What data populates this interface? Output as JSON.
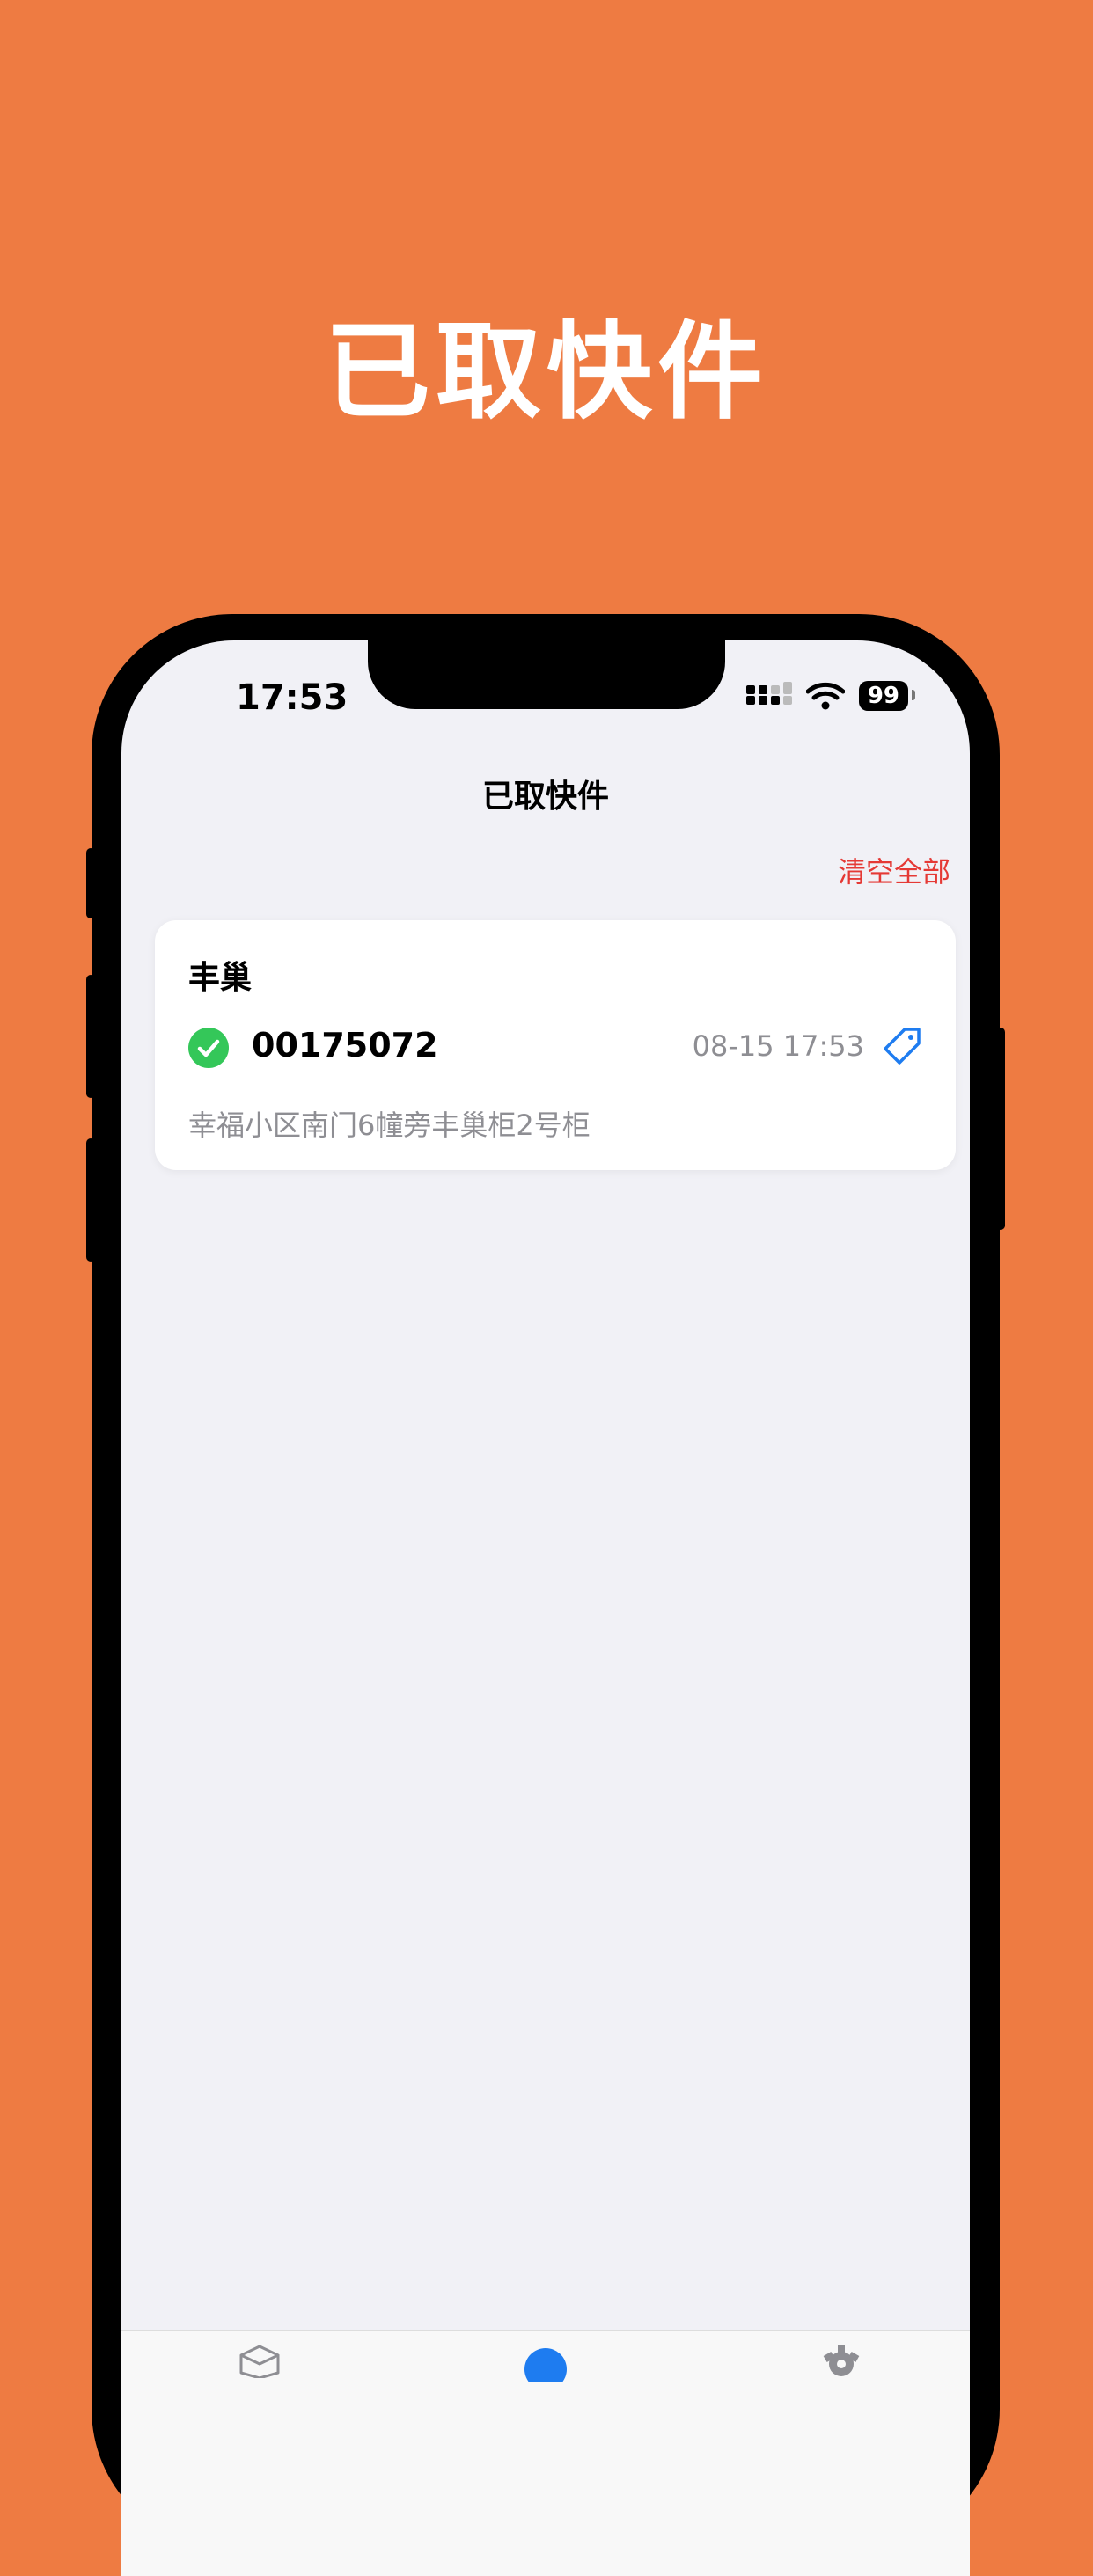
{
  "promo": {
    "title": "已取快件"
  },
  "status_bar": {
    "time": "17:53",
    "battery": "99",
    "icons": [
      "signal-icon",
      "wifi-icon",
      "battery-icon"
    ]
  },
  "nav": {
    "title": "已取快件",
    "clear_all": "清空全部"
  },
  "parcels": [
    {
      "company": "丰巢",
      "code": "00175072",
      "time": "08-15 17:53",
      "address": "幸福小区南门6幢旁丰巢柜2号柜",
      "status_icon": "check-circle-icon",
      "action_icon": "tag-icon"
    }
  ],
  "tab_bar": {
    "icons": [
      "box-icon",
      "circle-icon",
      "gear-icon"
    ]
  },
  "colors": {
    "background": "#EE7B42",
    "accent": "#1E7CF0",
    "danger": "#E53935",
    "success": "#34C759"
  }
}
